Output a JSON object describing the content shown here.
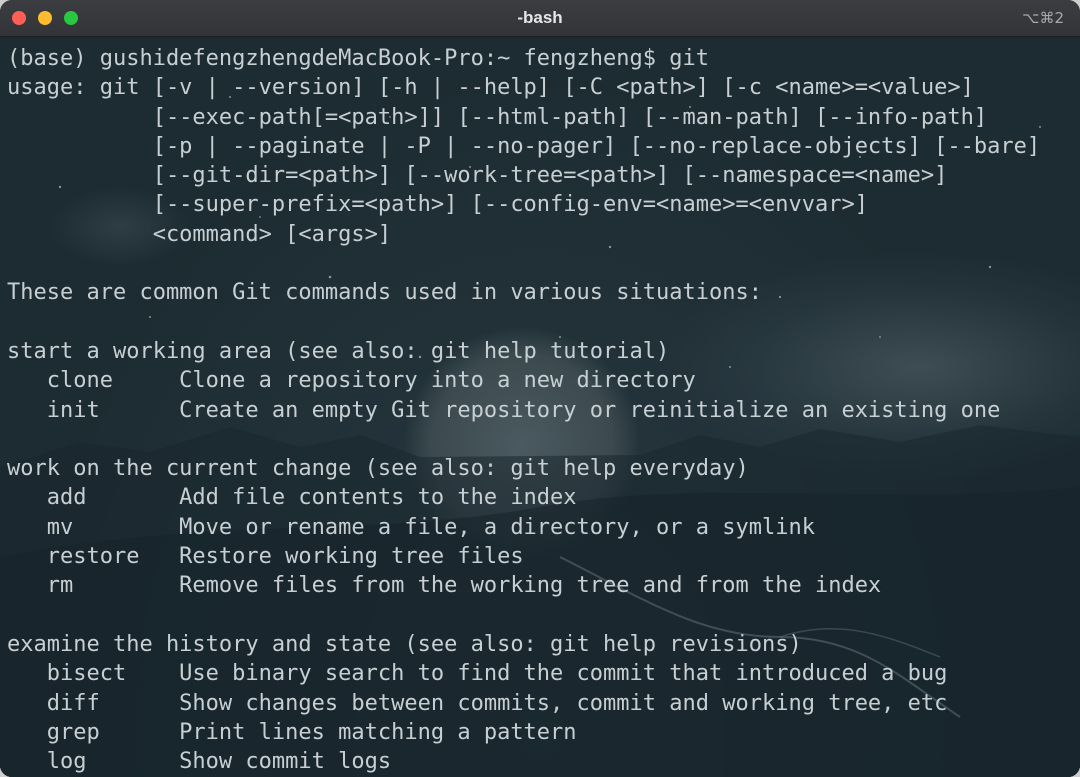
{
  "window": {
    "title": "-bash",
    "shortcut": "⌥⌘2"
  },
  "terminal": {
    "lines": [
      "(base) gushidefengzhengdeMacBook-Pro:~ fengzheng$ git",
      "usage: git [-v | --version] [-h | --help] [-C <path>] [-c <name>=<value>]",
      "           [--exec-path[=<path>]] [--html-path] [--man-path] [--info-path]",
      "           [-p | --paginate | -P | --no-pager] [--no-replace-objects] [--bare]",
      "           [--git-dir=<path>] [--work-tree=<path>] [--namespace=<name>]",
      "           [--super-prefix=<path>] [--config-env=<name>=<envvar>]",
      "           <command> [<args>]",
      "",
      "These are common Git commands used in various situations:",
      "",
      "start a working area (see also: git help tutorial)",
      "   clone     Clone a repository into a new directory",
      "   init      Create an empty Git repository or reinitialize an existing one",
      "",
      "work on the current change (see also: git help everyday)",
      "   add       Add file contents to the index",
      "   mv        Move or rename a file, a directory, or a symlink",
      "   restore   Restore working tree files",
      "   rm        Remove files from the working tree and from the index",
      "",
      "examine the history and state (see also: git help revisions)",
      "   bisect    Use binary search to find the commit that introduced a bug",
      "   diff      Show changes between commits, commit and working tree, etc",
      "   grep      Print lines matching a pattern",
      "   log       Show commit logs"
    ]
  }
}
